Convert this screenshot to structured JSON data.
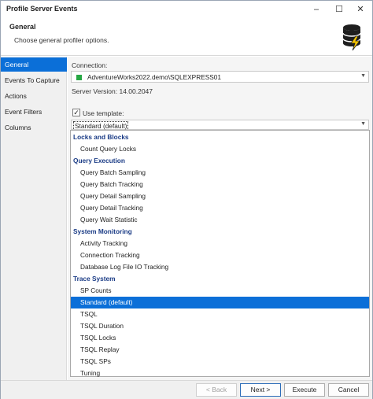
{
  "window": {
    "title": "Profile Server Events",
    "minimize_glyph": "–",
    "maximize_glyph": "☐",
    "close_glyph": "✕"
  },
  "header": {
    "title": "General",
    "subtitle": "Choose general profiler options.",
    "icon": "database-lightning-icon"
  },
  "sidebar": {
    "items": [
      {
        "label": "General",
        "active": true
      },
      {
        "label": "Events To Capture",
        "active": false
      },
      {
        "label": "Actions",
        "active": false
      },
      {
        "label": "Event Filters",
        "active": false
      },
      {
        "label": "Columns",
        "active": false
      }
    ]
  },
  "connection": {
    "label": "Connection:",
    "value": "AdventureWorks2022.demo\\SQLEXPRESS01",
    "status_color": "#27a744",
    "server_version": "Server Version: 14.00.2047"
  },
  "template": {
    "checkbox_label": "Use template:",
    "checked": true,
    "selected_value": "Standard (default)"
  },
  "dropdown": {
    "groups": [
      {
        "name": "Locks and Blocks",
        "items": [
          "Count Query Locks"
        ]
      },
      {
        "name": "Query Execution",
        "items": [
          "Query Batch Sampling",
          "Query Batch Tracking",
          "Query Detail Sampling",
          "Query Detail Tracking",
          "Query Wait Statistic"
        ]
      },
      {
        "name": "System Monitoring",
        "items": [
          "Activity Tracking",
          "Connection Tracking",
          "Database Log File IO Tracking"
        ]
      },
      {
        "name": "Trace System",
        "items": [
          "SP Counts",
          "Standard (default)",
          "TSQL",
          "TSQL Duration",
          "TSQL Locks",
          "TSQL Replay",
          "TSQL SPs",
          "Tuning"
        ]
      }
    ],
    "selected": "Standard (default)"
  },
  "footer": {
    "back_label": "< Back",
    "next_label": "Next >",
    "execute_label": "Execute",
    "cancel_label": "Cancel"
  },
  "colors": {
    "accent": "#0b6fd8",
    "group_heading": "#1b3c86"
  }
}
